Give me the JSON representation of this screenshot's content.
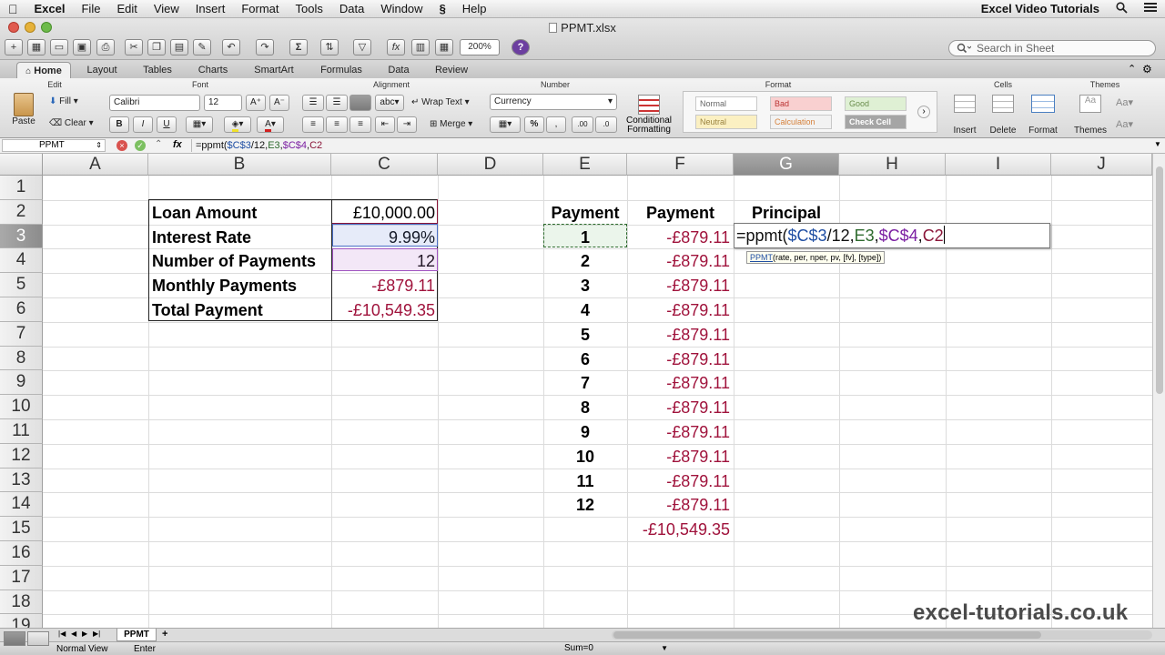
{
  "menubar": {
    "apple": "",
    "app_name": "Excel",
    "items": [
      "File",
      "Edit",
      "View",
      "Insert",
      "Format",
      "Tools",
      "Data",
      "Window",
      "Help"
    ],
    "right_title": "Excel Video Tutorials"
  },
  "window": {
    "doc_title": "PPMT.xlsx",
    "zoom": "200%",
    "search_placeholder": "Search in Sheet"
  },
  "ribbon": {
    "tabs": [
      "Home",
      "Layout",
      "Tables",
      "Charts",
      "SmartArt",
      "Formulas",
      "Data",
      "Review"
    ],
    "active_tab": "Home",
    "groups": {
      "edit": "Edit",
      "font": "Font",
      "alignment": "Alignment",
      "number": "Number",
      "format": "Format",
      "cells": "Cells",
      "themes": "Themes"
    },
    "paste_label": "Paste",
    "fill_label": "Fill",
    "clear_label": "Clear",
    "font_name": "Calibri",
    "font_size": "12",
    "bold": "B",
    "italic": "I",
    "underline": "U",
    "wrap_text": "Wrap Text",
    "merge": "Merge",
    "abc": "abc",
    "number_format": "Currency",
    "percent": "%",
    "conditional_formatting": "Conditional Formatting",
    "styles": [
      "Normal",
      "Bad",
      "Good",
      "Neutral",
      "Calculation",
      "Check Cell"
    ],
    "insert": "Insert",
    "delete": "Delete",
    "format": "Format",
    "themes": "Themes"
  },
  "formula_bar": {
    "name_box": "PPMT",
    "fx": "fx",
    "formula_parts": [
      {
        "text": "=ppmt(",
        "color": "#111111"
      },
      {
        "text": "$C$3",
        "color": "#1f4ea3"
      },
      {
        "text": "/12,",
        "color": "#111111"
      },
      {
        "text": "E3",
        "color": "#2d6a2d"
      },
      {
        "text": ",",
        "color": "#111111"
      },
      {
        "text": "$C$4",
        "color": "#7b1fa2"
      },
      {
        "text": ",",
        "color": "#111111"
      },
      {
        "text": "C2",
        "color": "#8a1538"
      }
    ]
  },
  "grid": {
    "columns": [
      "A",
      "B",
      "C",
      "D",
      "E",
      "F",
      "G",
      "H",
      "I",
      "J"
    ],
    "selected_column": "G",
    "rows": [
      "1",
      "2",
      "3",
      "4",
      "5",
      "6",
      "7",
      "8",
      "9",
      "10",
      "11",
      "12",
      "13",
      "14",
      "15",
      "16",
      "17",
      "18",
      "19"
    ],
    "selected_row": "3",
    "loan_table": [
      {
        "label": "Loan Amount",
        "value": "£10,000.00"
      },
      {
        "label": "Interest Rate",
        "value": "9.99%"
      },
      {
        "label": "Number of Payments",
        "value": "12"
      },
      {
        "label": "Monthly Payments",
        "value": "-£879.11"
      },
      {
        "label": "Total Payment",
        "value": "-£10,549.35"
      }
    ],
    "headers": {
      "e": "Payment",
      "f": "Payment",
      "g": "Principal"
    },
    "payment_numbers": [
      "1",
      "2",
      "3",
      "4",
      "5",
      "6",
      "7",
      "8",
      "9",
      "10",
      "11",
      "12"
    ],
    "payment_values": [
      "-£879.11",
      "-£879.11",
      "-£879.11",
      "-£879.11",
      "-£879.11",
      "-£879.11",
      "-£879.11",
      "-£879.11",
      "-£879.11",
      "-£879.11",
      "-£879.11",
      "-£879.11"
    ],
    "total_value": "-£10,549.35",
    "active_cell_parts": [
      {
        "text": "=ppmt(",
        "color": "#111111"
      },
      {
        "text": "$C$3",
        "color": "#1f4ea3"
      },
      {
        "text": "/12,",
        "color": "#111111"
      },
      {
        "text": "E3",
        "color": "#2d6a2d"
      },
      {
        "text": ",",
        "color": "#111111"
      },
      {
        "text": "$C$4",
        "color": "#7b1fa2"
      },
      {
        "text": ",",
        "color": "#111111"
      },
      {
        "text": "C2",
        "color": "#8a1538"
      }
    ],
    "tooltip_fn": "PPMT",
    "tooltip_args": "(rate, per, nper, pv, [fv], [type])"
  },
  "sheet_tabs": [
    "PPMT"
  ],
  "status": {
    "view": "Normal View",
    "mode": "Enter",
    "sum": "Sum=0"
  },
  "watermark": "excel-tutorials.co.uk",
  "colors": {
    "negative": "#a0133c",
    "ref_c3": "#1f4ea3",
    "ref_e3": "#2d6a2d",
    "ref_c4": "#7b1fa2",
    "ref_c2": "#8a1538"
  }
}
